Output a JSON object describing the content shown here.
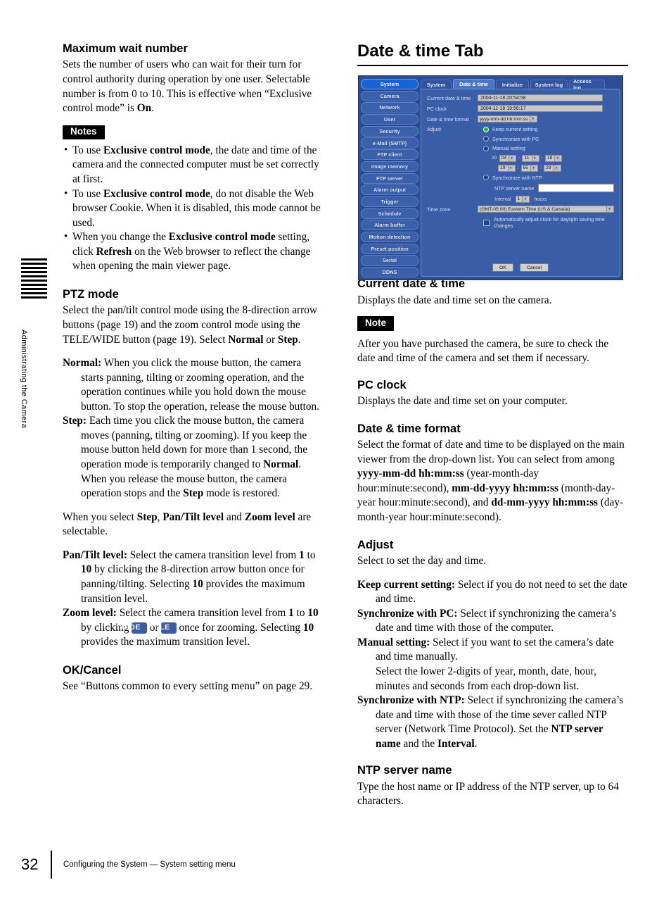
{
  "side_tab": {
    "label": "Administrating the Camera"
  },
  "left_column": {
    "heading_1": "Maximum wait number",
    "para_1_a": "Sets the number of users who can wait for their turn for control authority during operation by one user.",
    "para_1_b_pre": "Selectable number is from 0 to 10. This is effective when “Exclusive control mode” is ",
    "para_1_b_bold": "On",
    "para_1_b_post": ".",
    "notes_badge": "Notes",
    "notes": [
      {
        "pre": "To use ",
        "bold": "Exclusive control mode",
        "post": ", the date and time of the camera and the connected computer must be set correctly at first."
      },
      {
        "pre": "To use ",
        "bold": "Exclusive control mode",
        "post": ", do not disable the Web browser Cookie. When it is disabled, this mode cannot be used."
      },
      {
        "pre": "When you change the ",
        "bold": "Exclusive control mode",
        "post": " setting, click ",
        "bold2": "Refresh",
        "post2": " on the Web browser to reflect the change when opening the main viewer page."
      }
    ],
    "heading_2": "PTZ mode",
    "ptz_para_a": "Select the pan/tilt control mode using the 8-direction arrow buttons (page 19) and the zoom control mode using the TELE/WIDE button (page 19).",
    "ptz_para_b_pre": "Select ",
    "ptz_para_b_b1": "Normal",
    "ptz_para_b_mid": " or ",
    "ptz_para_b_b2": "Step",
    "ptz_para_b_post": ".",
    "normal_term": "Normal:",
    "normal_def": " When you click the mouse button, the camera starts panning, tilting or zooming operation, and the operation continues while you hold down the mouse button. To stop the operation, release the mouse button.",
    "step_term": "Step:",
    "step_def_a": " Each time you click the mouse button, the camera moves (panning, tilting or zooming). If you keep the mouse button held down for more than 1 second, the operation mode is temporarily changed to ",
    "step_def_b1": "Normal",
    "step_def_b": ". When you release the mouse button, the camera operation stops and the ",
    "step_def_b2": "Step",
    "step_def_c": " mode is restored.",
    "select_step_pre": "When you select ",
    "select_step_b1": "Step",
    "select_step_mid1": ", ",
    "select_step_b2": "Pan/Tilt level",
    "select_step_mid2": " and ",
    "select_step_b3": "Zoom level",
    "select_step_post": " are selectable.",
    "pantilt_term": "Pan/Tilt level:",
    "pantilt_a": " Select the camera transition level from ",
    "pantilt_b1": "1",
    "pantilt_b": " to ",
    "pantilt_b2": "10",
    "pantilt_c": " by clicking the 8-direction arrow button once for panning/tilting. Selecting ",
    "pantilt_b3": "10",
    "pantilt_d": " provides the maximum transition level.",
    "zoom_term": "Zoom level:",
    "zoom_a": " Select the camera transition level from ",
    "zoom_b1": "1",
    "zoom_b": " to ",
    "zoom_b2": "10",
    "zoom_c": " by clicking ",
    "zoom_btn_wide": "WIDE",
    "zoom_mid": " or ",
    "zoom_btn_tele": "TELE",
    "zoom_d": " once for zooming. Selecting ",
    "zoom_b3": "10",
    "zoom_e": " provides the maximum transition level.",
    "heading_3": "OK/Cancel",
    "okcancel_para": "See “Buttons common to every setting menu” on page 29."
  },
  "right_column": {
    "title": "Date & time Tab",
    "heading_current": "Current date & time",
    "current_para": "Displays the date and time set on the camera.",
    "note_badge": "Note",
    "note_para": "After you have purchased the camera, be sure to check the date and time of the camera and set them if necessary.",
    "heading_pcclock": "PC clock",
    "pcclock_para": "Displays the date and time set on your computer.",
    "heading_format": "Date & time format",
    "format_a": "Select the format of date and time to be displayed on the main viewer from the drop-down list.",
    "format_b_pre": "You can select from among ",
    "format_b1": "yyyy-mm-dd hh:mm:ss",
    "format_b_mid1": " (year-month-day hour:minute:second), ",
    "format_b2": "mm-dd-yyyy hh:mm:ss",
    "format_b_mid2": " (month-day-year hour:minute:second), and ",
    "format_b3": "dd-mm-yyyy hh:mm:ss",
    "format_b_post": " (day-month-year hour:minute:second).",
    "heading_adjust": "Adjust",
    "adjust_para": "Select to set the day and time.",
    "adjust_items": [
      {
        "term": "Keep current setting:",
        "def": " Select if you do not need to set the date and time."
      },
      {
        "term": "Synchronize with PC:",
        "def": " Select if synchronizing the camera’s date and time with those of the computer."
      },
      {
        "term": "Manual setting:",
        "def": " Select if you want to set the camera’s date and time manually."
      },
      {
        "term": "",
        "def": "Select the lower 2-digits of year, month, date, hour, minutes and seconds from each drop-down list."
      }
    ],
    "ntp_term": "Synchronize with NTP:",
    "ntp_def_a": " Select if synchronizing the camera’s date and time with those of the time sever called NTP server (Network Time Protocol). Set the ",
    "ntp_b1": "NTP server name",
    "ntp_def_b": " and the ",
    "ntp_b2": "Interval",
    "ntp_def_c": ".",
    "heading_ntpname": "NTP server name",
    "ntpname_para": "Type the host name or IP address of the NTP server, up to 64 characters."
  },
  "screenshot": {
    "sidebar_items": [
      "System",
      "Camera",
      "Network",
      "User",
      "Security",
      "e-Mail (SMTP)",
      "FTP client",
      "Image memory",
      "FTP server",
      "Alarm output",
      "Trigger",
      "Schedule",
      "Alarm buffer",
      "Motion detection",
      "Preset position",
      "Serial",
      "DDNS"
    ],
    "sidebar_active": "System",
    "tabs": [
      "System",
      "Date & time",
      "Initialize",
      "System log",
      "Access log"
    ],
    "tab_active": "Date & time",
    "fields": {
      "current_label": "Current date & time",
      "current_value": "2004-11-18  20:54:58",
      "pcclock_label": "PC clock",
      "pcclock_value": "2004-11-18  19:56:17",
      "format_label": "Date & time format",
      "format_value": "yyyy-mm-dd hh:mm:ss",
      "adjust_label": "Adjust",
      "radio_keep": "Keep current setting",
      "radio_pc": "Synchronize with PC",
      "radio_manual": "Manual setting",
      "radio_ntp": "Synchronize with NTP",
      "radio_selected": "Keep current setting",
      "manual_year_prefix": "20",
      "manual_year": "04",
      "manual_month": "11",
      "manual_day": "18",
      "manual_hour": "19",
      "manual_minute": "55",
      "manual_second": "29",
      "date_sep": "-",
      "time_sep": ":",
      "ntp_name_label": "NTP server name",
      "ntp_name_value": "",
      "interval_label": "Interval",
      "interval_value": "1",
      "interval_unit": "hours",
      "timezone_label": "Time zone",
      "timezone_value": "(GMT-05:00) Eastern Time (US & Canada)",
      "dst_label": "Automatically adjust clock for daylight saving time changes",
      "ok_label": "OK",
      "cancel_label": "Cancel"
    }
  },
  "footer": {
    "page_number": "32",
    "text": "Configuring the System — System setting menu"
  }
}
